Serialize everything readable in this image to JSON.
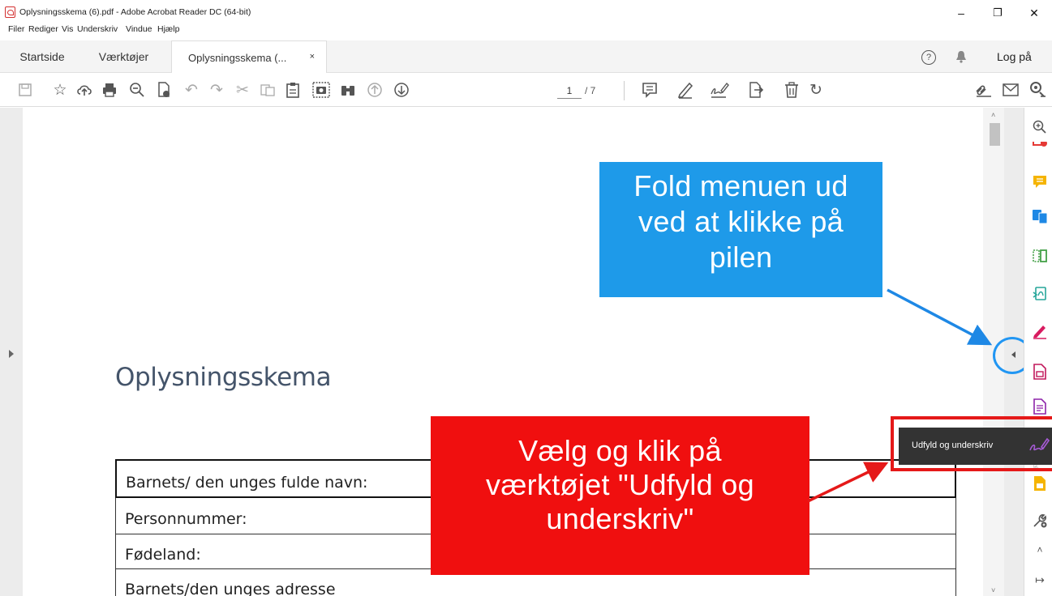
{
  "window": {
    "title": "Oplysningsskema (6).pdf - Adobe Acrobat Reader DC (64-bit)",
    "minimize": "–",
    "restore": "❐",
    "close": "✕"
  },
  "menu": [
    "Filer",
    "Rediger",
    "Vis",
    "Underskriv",
    "Vindue",
    "Hjælp"
  ],
  "tabs": {
    "home": "Startside",
    "tools": "Værktøjer",
    "document": "Oplysningsskema (...",
    "close": "×"
  },
  "header_right": {
    "help": "?",
    "bell": "🔔",
    "login": "Log på"
  },
  "toolbar": {
    "page_current": "1",
    "page_total": "/ 7"
  },
  "document": {
    "heading": "Oplysningsskema",
    "rows": [
      "Barnets/ den unges fulde navn:",
      "Personnummer:",
      "Fødeland:",
      "Barnets/den unges adresse"
    ]
  },
  "tooltip": {
    "label": "Udfyld og underskriv"
  },
  "callouts": {
    "blue": [
      "Fold menuen ud",
      "ved at klikke på",
      "pilen"
    ],
    "red": [
      "Vælg og klik på",
      "værktøjet \"Udfyld og",
      "underskriv\""
    ]
  },
  "colors": {
    "blue_callout": "#1e9ae9",
    "red_callout": "#f00f0f",
    "heading": "#44546a"
  }
}
